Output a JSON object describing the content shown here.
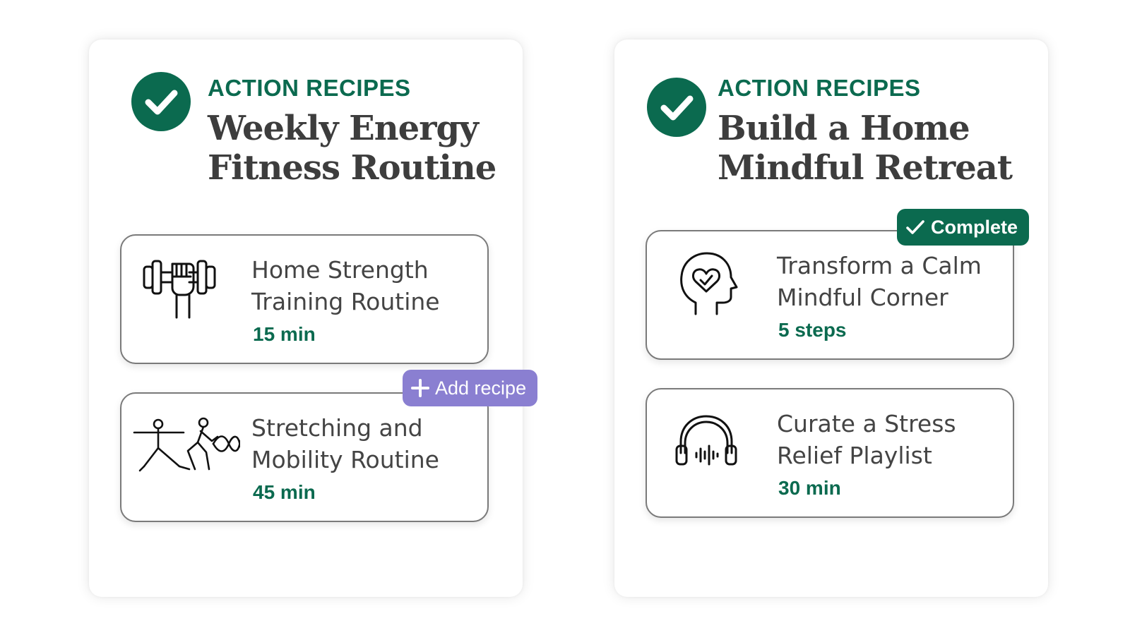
{
  "colors": {
    "brand_green": "#0b6a4f",
    "add_purple": "#8a7fd1",
    "title_gray": "#3d3d3d",
    "card_border": "#7a7a7a"
  },
  "panels": [
    {
      "eyebrow": "ACTION RECIPES",
      "title_line1": "Weekly Energy",
      "title_line2": "Fitness Routine",
      "badge_icon": "check-circle-icon",
      "cards": [
        {
          "icon": "dumbbell-fist-icon",
          "title_line1": "Home Strength",
          "title_line2": "Training Routine",
          "meta": "15 min"
        },
        {
          "icon": "stretching-figures-icon",
          "title_line1": "Stretching and",
          "title_line2": "Mobility Routine",
          "meta": "45 min",
          "action_label": "Add recipe",
          "action_icon": "plus-icon"
        }
      ]
    },
    {
      "eyebrow": "ACTION RECIPES",
      "title_line1": "Build a Home",
      "title_line2": "Mindful Retreat",
      "badge_icon": "check-circle-icon",
      "cards": [
        {
          "icon": "mind-heart-icon",
          "title_line1": "Transform a Calm",
          "title_line2": "Mindful Corner",
          "meta": "5 steps",
          "status_label": "Complete",
          "status_icon": "check-icon"
        },
        {
          "icon": "headphones-icon",
          "title_line1": "Curate a Stress",
          "title_line2": "Relief Playlist",
          "meta": "30 min"
        }
      ]
    }
  ]
}
